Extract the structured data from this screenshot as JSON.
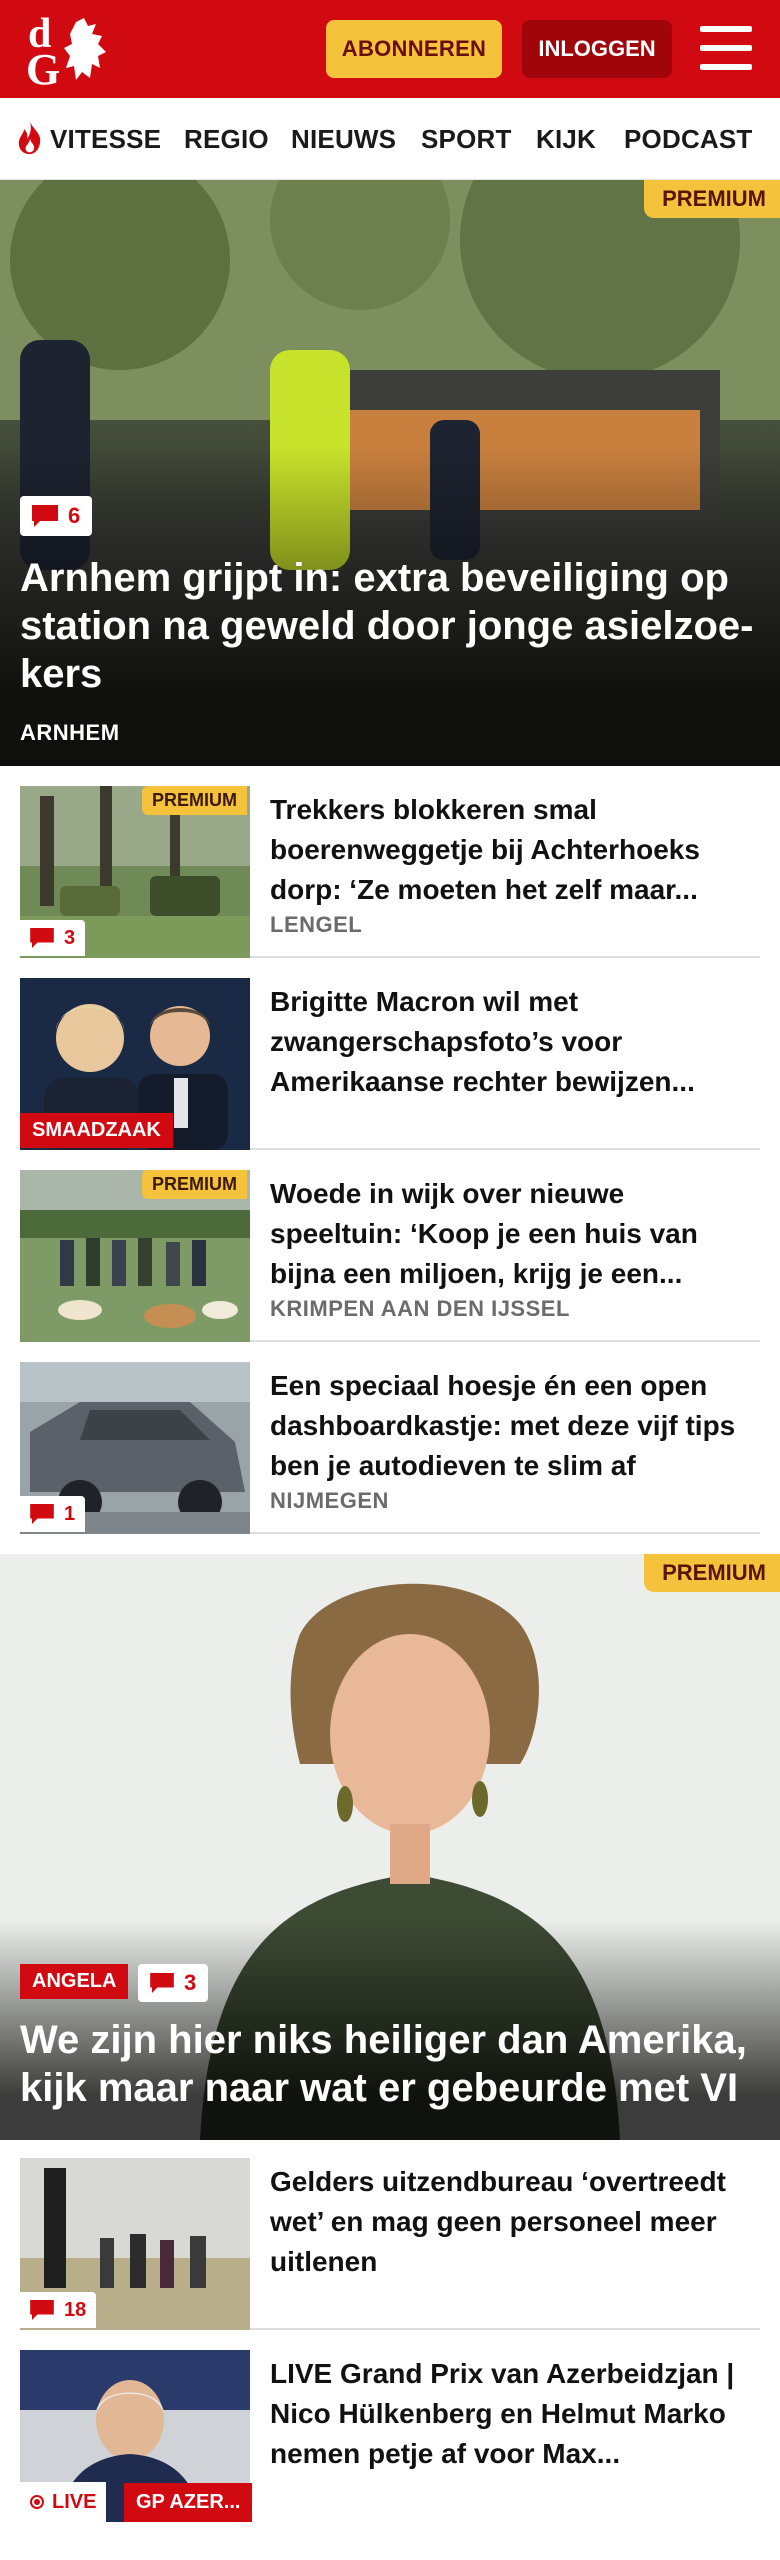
{
  "header": {
    "logo_text_top": "d",
    "logo_text_bottom": "G",
    "subscribe_label": "ABONNEREN",
    "login_label": "INLOGGEN",
    "brand_color": "#d10a11"
  },
  "nav": {
    "items": [
      "VITESSE",
      "REGIO",
      "NIEUWS",
      "SPORT",
      "KIJK",
      "PODCAST"
    ]
  },
  "hero": {
    "premium": "PREMIUM",
    "comments": "6",
    "title": "Arnhem grijpt in: extra beveiliging op station na geweld door jonge asielzoe­kers",
    "location": "ARNHEM"
  },
  "articles": [
    {
      "title": "Trekkers blokkeren smal boerenweggetje bij Achterhoeks dorp: ‘Ze moeten het zelf maar...",
      "location": "LENGEL",
      "premium": "PREMIUM",
      "comments": "3"
    },
    {
      "title": "Brigitte Macron wil met zwangerschapsfoto’s voor Amerikaanse rechter bewijzen...",
      "tag": "SMAADZAAK"
    },
    {
      "title": "Woede in wijk over nieuwe speeltuin: ‘Koop je een huis van bijna een miljoen, krijg je een...",
      "location": "KRIMPEN AAN DEN IJSSEL",
      "premium": "PREMIUM"
    },
    {
      "title": "Een speciaal hoesje én een open dashboardkastje: met deze vijf tips ben je autodieven te slim af",
      "location": "NIJMEGEN",
      "comments": "1"
    }
  ],
  "feature": {
    "premium": "PREMIUM",
    "tag": "ANGELA",
    "comments": "3",
    "title": "We zijn hier niks heiliger dan Amerika, kijk maar naar wat er gebeurde met VI"
  },
  "articles2": [
    {
      "title": "Gelders uitzendbureau ‘overtreedt wet’ en mag geen personeel meer uitlenen",
      "comments": "18"
    },
    {
      "title": "LIVE Grand Prix van Azerbeidzjan | Nico Hülkenberg en Helmut Marko nemen petje af voor Max...",
      "live": "LIVE",
      "tag": "GP AZER..."
    }
  ]
}
